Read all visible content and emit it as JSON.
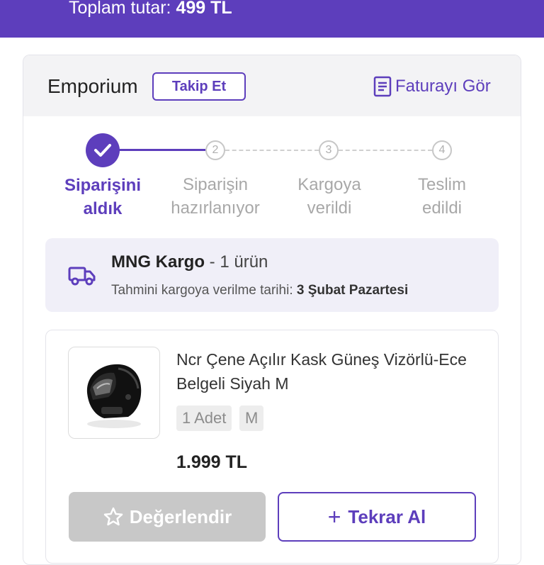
{
  "header": {
    "total_label": "Toplam tutar:",
    "total_value": "499 TL"
  },
  "seller": {
    "name": "Emporium",
    "follow_label": "Takip Et",
    "invoice_label": "Faturayı Gör",
    "invoice_icon": "document-icon"
  },
  "steps": [
    {
      "number": "1",
      "line1": "Siparişini",
      "line2": "aldık",
      "status": "done"
    },
    {
      "number": "2",
      "line1": "Siparişin",
      "line2": "hazırlanıyor",
      "status": "pending"
    },
    {
      "number": "3",
      "line1": "Kargoya",
      "line2": "verildi",
      "status": "pending"
    },
    {
      "number": "4",
      "line1": "Teslim",
      "line2": "edildi",
      "status": "pending"
    }
  ],
  "cargo": {
    "icon": "truck-icon",
    "company": "MNG Kargo",
    "count_text": "- 1 ürün",
    "date_label": "Tahmini kargoya verilme tarihi:",
    "date_value": "3 Şubat Pazartesi"
  },
  "product": {
    "name": "Ncr Çene Açılır Kask Güneş Vizörlü-Ece Belgeli Siyah M",
    "quantity": "1 Adet",
    "size": "M",
    "price": "1.999 TL",
    "rate_label": "Değerlendir",
    "buy_again_label": "Tekrar Al"
  },
  "colors": {
    "brand": "#5d3ebc",
    "disabled": "#c8c8c8"
  }
}
